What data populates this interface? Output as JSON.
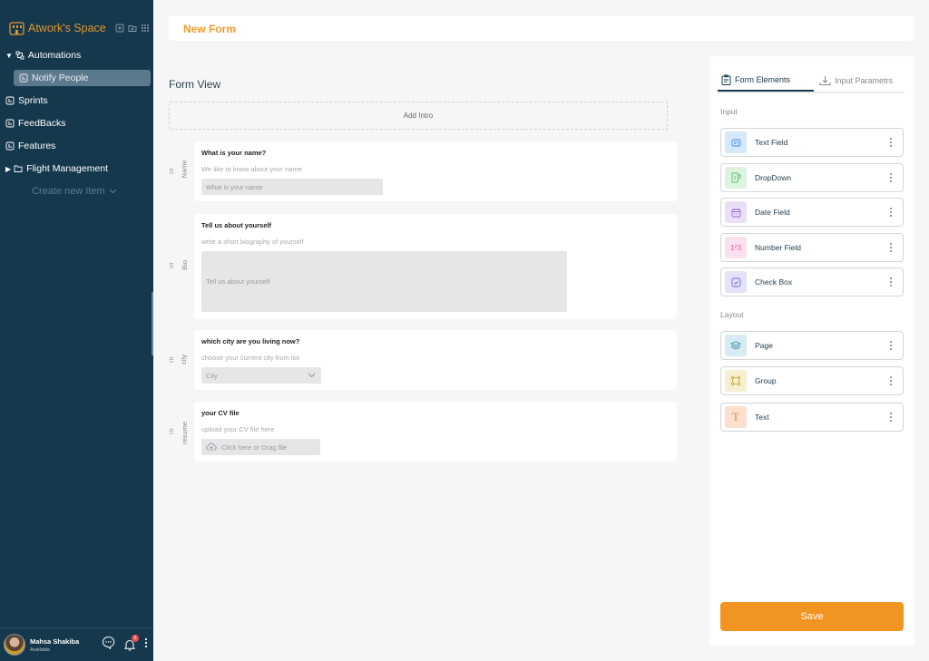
{
  "sidebar": {
    "workspace_title": "Atwork's Space",
    "items": [
      {
        "label": "Automations",
        "icon": "automation-icon",
        "expanded": true
      },
      {
        "label": "Notify People",
        "icon": "document-icon",
        "active": true
      },
      {
        "label": "Sprints",
        "icon": "document-icon"
      },
      {
        "label": "FeedBacks",
        "icon": "document-icon"
      },
      {
        "label": "Features",
        "icon": "document-icon"
      },
      {
        "label": "Flight Management",
        "icon": "folder-icon",
        "expanded": false
      }
    ],
    "create_new_label": "Create new Item",
    "user": {
      "name": "Mahsa Shakiba",
      "status": "Available"
    },
    "notification_count": "2"
  },
  "header": {
    "title": "New Form"
  },
  "form_view": {
    "title": "Form View",
    "add_intro_label": "Add Intro",
    "fields": [
      {
        "key": "Name",
        "label": "What is your name?",
        "description": "We like to know about your name",
        "placeholder": "What is your name",
        "type": "text"
      },
      {
        "key": "Bio",
        "label": "Tell us about yourself",
        "description": "write a short biography of yourself",
        "placeholder": "Tell us about yourself",
        "type": "textarea"
      },
      {
        "key": "city",
        "label": "which city are you living now?",
        "description": "choose your current city from list",
        "placeholder": "City",
        "type": "dropdown"
      },
      {
        "key": "resume",
        "label": "your CV file",
        "description": "upload your CV file here",
        "placeholder": "Click here or Drag file",
        "type": "file"
      }
    ]
  },
  "right_panel": {
    "tabs": [
      {
        "label": "Form Elements",
        "active": true
      },
      {
        "label": "Input Parametrs",
        "active": false
      }
    ],
    "input_section_label": "Input",
    "input_elements": [
      {
        "label": "Text Field",
        "icon": "text-field-icon",
        "color": "#d6e9fb",
        "fg": "#4a90d9"
      },
      {
        "label": "DropDown",
        "icon": "dropdown-icon",
        "color": "#dcf3df",
        "fg": "#5cbf6e"
      },
      {
        "label": "Date Field",
        "icon": "calendar-icon",
        "color": "#ebdff8",
        "fg": "#9b6cd6"
      },
      {
        "label": "Number Field",
        "icon": "number-icon",
        "color": "#fbe0ef",
        "fg": "#e467a9",
        "glyph": "1²3"
      },
      {
        "label": "Check Box",
        "icon": "checkbox-icon",
        "color": "#e4e2f8",
        "fg": "#6f66d4"
      }
    ],
    "layout_section_label": "Layout",
    "layout_elements": [
      {
        "label": "Page",
        "icon": "layers-icon",
        "color": "#d7ebf2",
        "fg": "#3d93b3"
      },
      {
        "label": "Group",
        "icon": "group-icon",
        "color": "#f7efd2",
        "fg": "#d1a93c"
      },
      {
        "label": "Text",
        "icon": "text-icon",
        "color": "#fbe0cd",
        "fg": "#e5894d",
        "glyph": "T"
      }
    ],
    "save_label": "Save"
  }
}
